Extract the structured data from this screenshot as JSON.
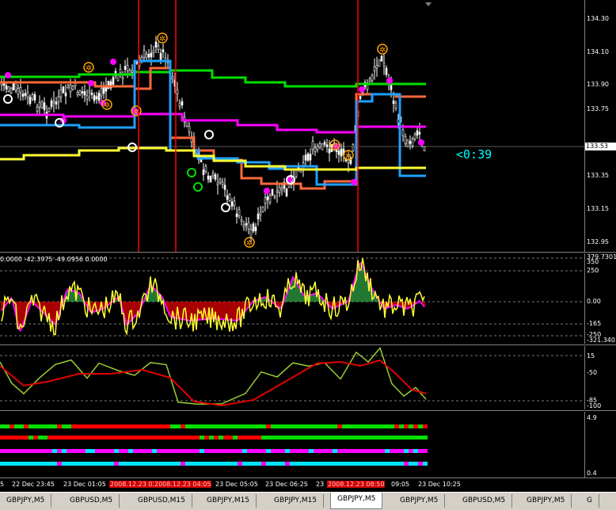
{
  "price_axis": {
    "labels": [
      "134.30",
      "134.10",
      "133.90",
      "133.75",
      "133.53",
      "133.35",
      "133.15",
      "132.95"
    ],
    "current": "133.53"
  },
  "timer": "<0:39",
  "osc1": {
    "indicator_label": "0.0000 -42.3975 -49.0956 0.0000",
    "axis_labels": [
      "379.7301",
      "350",
      "250",
      "0.00",
      "-165",
      "-250",
      "-321.340"
    ]
  },
  "osc2": {
    "axis_labels": [
      "15",
      "-50",
      "-85",
      "-100"
    ]
  },
  "osc3": {
    "axis_labels": [
      "4.9",
      "0.4"
    ]
  },
  "time_axis": {
    "labels": [
      "5",
      "22 Dec 23:45",
      "23 Dec 01:05",
      "2008.12.23 02:3",
      "2008.12.23 04:05",
      "23 Dec 05:05",
      "23 Dec 06:25",
      "23",
      "2008.12.23 08:50",
      "09:05",
      "23 Dec 10:25"
    ]
  },
  "tabs": [
    "GBPJPY,M5",
    "GBPUSD,M5",
    "GBPUSD,M15",
    "GBPJPY,M15",
    "GBPJPY,M15",
    "GBPJPY,M5",
    "GBPJPY,M5",
    "GBPUSD,M5",
    "GBPJPY,M5",
    "G"
  ],
  "colors": {
    "red_vline": "#ff0000",
    "green_line": "#00e000",
    "orange_line": "#ff6a3a",
    "magenta_line": "#ff00ff",
    "blue_line": "#1ea0ff",
    "yellow_line": "#ffff33"
  }
}
